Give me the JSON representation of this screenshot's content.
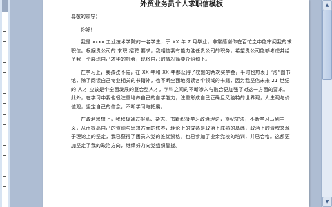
{
  "doc": {
    "title": "外贸业务员个人求职信模板",
    "salutation": "尊敬的领导：",
    "greeting": "你好！",
    "para1": "我是 xxxx 工业技术学院的一名学生，于 XX 年 7 月毕业，非常感谢你在百忙之中能审阅我的求职信。根据贵公司的 求职 招聘 要求，我相信我有能力胜任贵公司的职务，希望贵公司能够考虑并给予我一个展现自己才华的机会，现将自己的情况简要介绍如下。",
    "para2": "在学习上，我孜孜不倦，在 XX 年和 XX 年都获得了校颁的两次奖学金，平时也热衷于“泡”图书馆，除了阅读自己专业相关的书籍外，也不断全面地阅读各个领域的书籍，因为我坚信未来 21 世纪的 人才 应该是个全面发展的复合型人才，学科之间的不断渗入与融合更加强了对这一方面的要求。此外，在学习中我也很注重培养自己的自学能力，注重形成自己正确且又独特的世界观，人生观与价值观，坚定自己的信念，不断学习与拓展。",
    "para3": "在政治思想上，我积极通过报纸、杂志、书籍积极学习政治理论，遵纪守法，不断学习马列主义，从而提高自己的道德与思想方面的修养，理论上的成熟是政治上成熟的基础，政治上的清醒来源于理论上的坚定，我已获得了团员入党的推优资格，也已参加了业余党校的培训，并已合格。这都更加坚定了我的政治方向，继续努力向党组织靠拢。"
  },
  "scroll": {
    "up_icon": "▲",
    "down_icon": "▼"
  }
}
